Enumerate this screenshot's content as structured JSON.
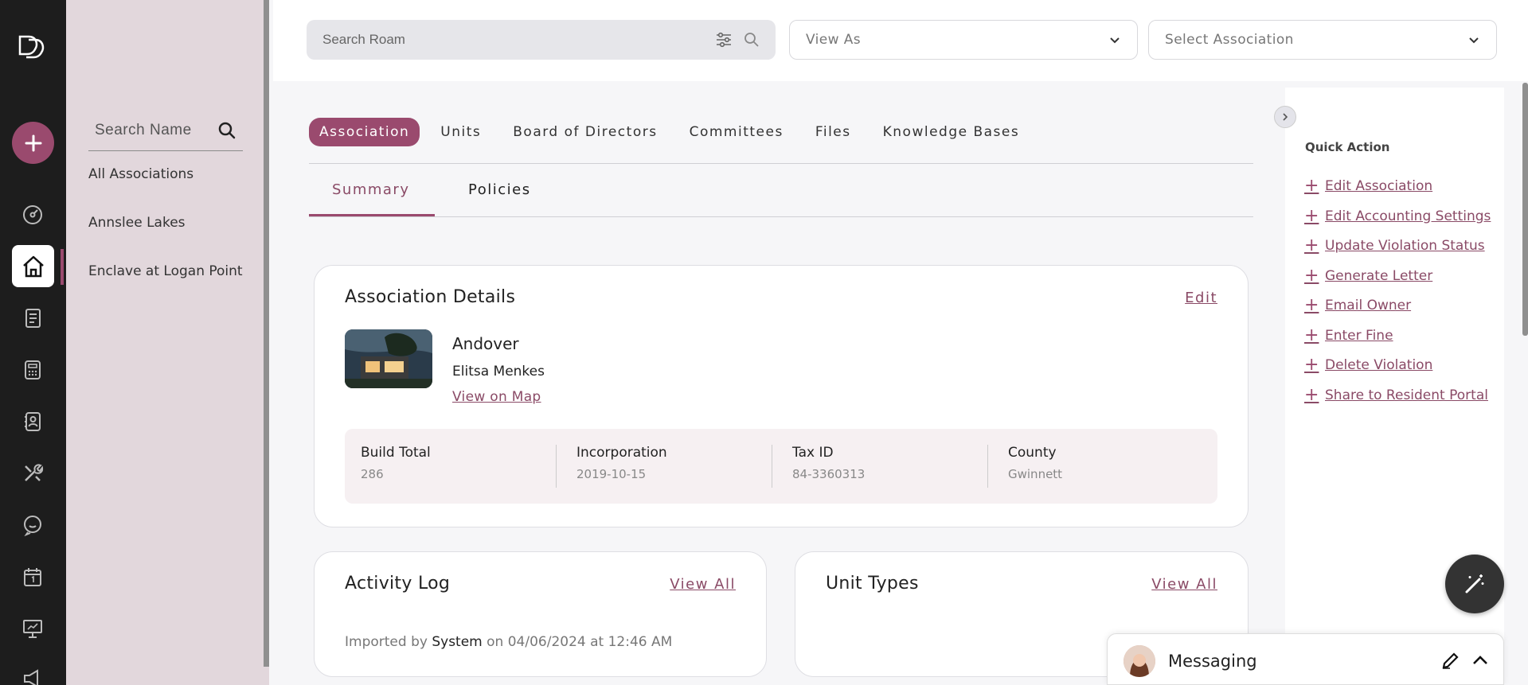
{
  "search": {
    "placeholder": "Search Roam"
  },
  "view_as": {
    "placeholder": "View As"
  },
  "select_association": {
    "placeholder": "Select Association"
  },
  "assoc_panel": {
    "search_placeholder": "Search Name",
    "items": [
      "All Associations",
      "Annslee Lakes",
      "Enclave at Logan Point"
    ]
  },
  "tabs": [
    "Association",
    "Units",
    "Board of Directors",
    "Committees",
    "Files",
    "Knowledge Bases"
  ],
  "subtabs": [
    "Summary",
    "Policies"
  ],
  "details": {
    "title": "Association Details",
    "edit_label": "Edit",
    "name": "Andover",
    "manager": "Elitsa Menkes",
    "map_link": "View on Map",
    "stats": [
      {
        "label": "Build Total",
        "value": "286"
      },
      {
        "label": "Incorporation",
        "value": "2019-10-15"
      },
      {
        "label": "Tax ID",
        "value": "84-3360313"
      },
      {
        "label": "County",
        "value": "Gwinnett"
      }
    ]
  },
  "activity": {
    "title": "Activity Log",
    "view_all": "View All",
    "prefix": "Imported by",
    "actor": "System",
    "suffix": "on 04/06/2024 at 12:46 AM"
  },
  "unit_types": {
    "title": "Unit Types",
    "view_all": "View All"
  },
  "quick_action": {
    "title": "Quick Action",
    "items": [
      "Edit Association",
      "Edit Accounting Settings",
      "Update Violation Status",
      "Generate Letter",
      "Email Owner",
      "Enter Fine",
      "Delete Violation",
      "Share to Resident Portal"
    ]
  },
  "messaging": {
    "label": "Messaging"
  },
  "colors": {
    "accent": "#9a4a6e",
    "rail": "#1d1d1d",
    "panel": "#e2d7dc"
  },
  "icons": [
    "logo-icon",
    "plus-icon",
    "dashboard-icon",
    "home-icon",
    "ledger-icon",
    "calculator-icon",
    "contacts-icon",
    "tools-icon",
    "chat-icon",
    "calendar-icon",
    "presentation-icon",
    "megaphone-icon",
    "search-icon",
    "filter-icon",
    "chevron-down-icon",
    "chevron-right-icon",
    "magic-wand-icon",
    "edit-icon",
    "chevron-up-icon"
  ]
}
